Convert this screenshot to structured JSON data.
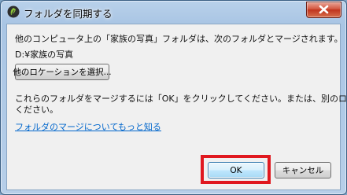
{
  "window": {
    "title": "フォルダを同期する"
  },
  "dialog": {
    "message_line1": "他のコンピュータ上の「家族の写真」フォルダは、次のフォルダとマージされます。",
    "target_path": "D:¥家族の写真",
    "choose_location_label": "他のロケーションを選択...",
    "instruction_line1": "これらのフォルダをマージするには「OK」をクリックしてください。または、別のロケーションを選択して",
    "instruction_line2": "ください。",
    "learn_more_link": "フォルダのマージについてもっと知る",
    "ok_label": "OK",
    "cancel_label": "キャンセル"
  },
  "colors": {
    "highlight": "#e0181f",
    "link": "#0066cc"
  }
}
